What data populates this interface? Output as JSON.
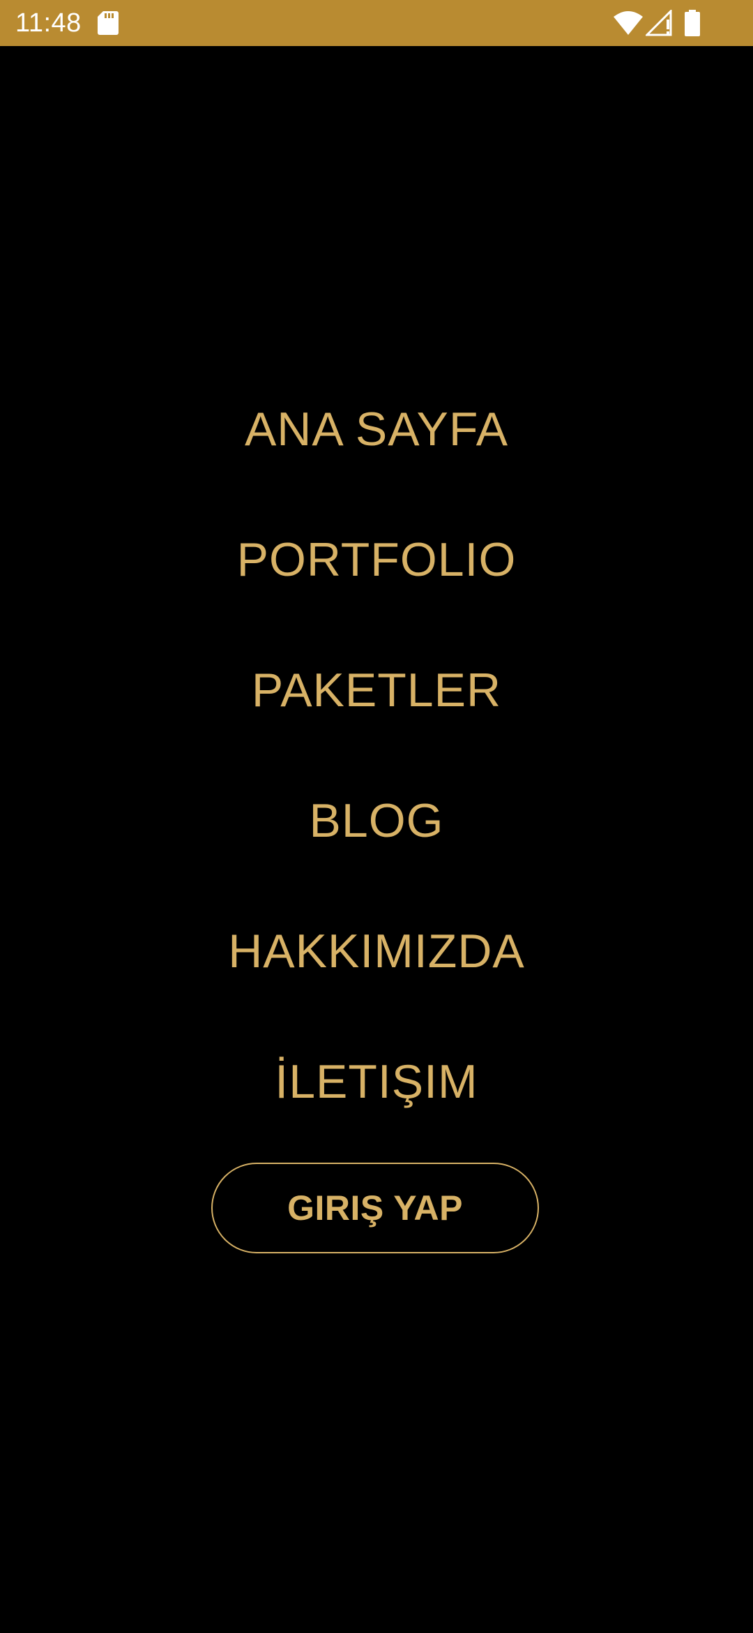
{
  "status_bar": {
    "time": "11:48",
    "background_color": "#B98B31",
    "icons": [
      "sd-card-icon",
      "wifi-icon",
      "signal-icon",
      "battery-icon"
    ]
  },
  "menu": {
    "text_color": "#D8B266",
    "items": [
      {
        "label": "ANA SAYFA"
      },
      {
        "label": "PORTFOLIO"
      },
      {
        "label": "PAKETLER"
      },
      {
        "label": "BLOG"
      },
      {
        "label": "HAKKIMIZDA"
      },
      {
        "label": "İLETIŞIM"
      }
    ]
  },
  "login": {
    "label": "GIRIŞ YAP",
    "border_color": "#D8B266"
  }
}
